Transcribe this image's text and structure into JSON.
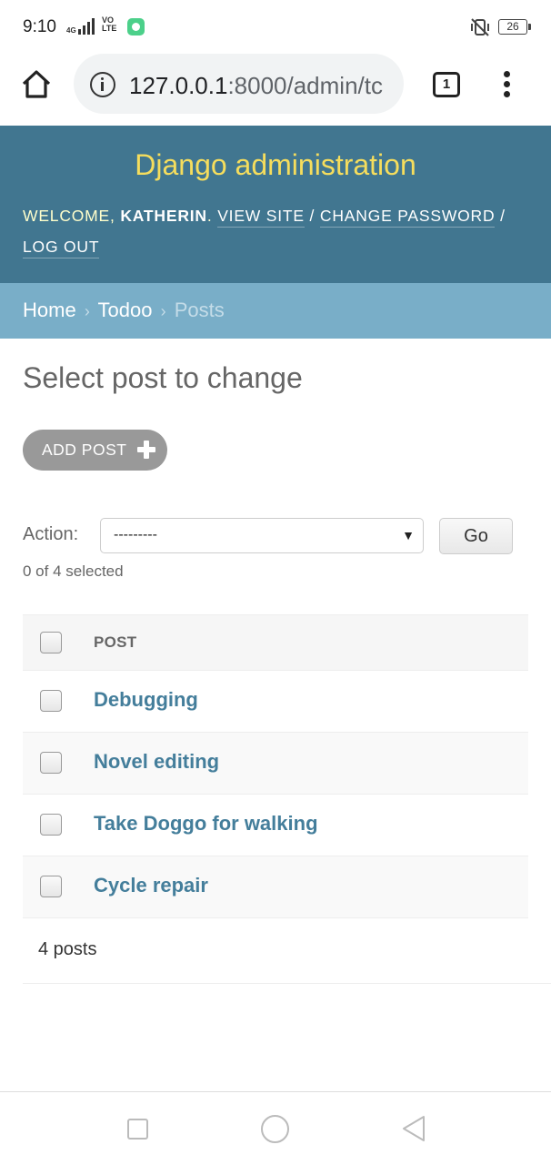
{
  "status_bar": {
    "time": "9:10",
    "network": "4G",
    "volte": "VO\nLTE",
    "battery": "26",
    "icons": [
      "signal-icon",
      "chat-app-icon",
      "mute-vibrate-icon",
      "battery-icon"
    ]
  },
  "browser": {
    "url_host": "127.0.0.1",
    "url_path": ":8000/admin/tc",
    "tab_count": "1",
    "icons": [
      "home-icon",
      "info-icon",
      "tabs-icon",
      "more-vert-icon"
    ]
  },
  "header": {
    "branding": "Django administration",
    "welcome_prefix": "WELCOME, ",
    "username": "KATHERIN",
    "period": ". ",
    "view_site": "VIEW SITE",
    "sep1": " / ",
    "change_password": "CHANGE PASSWORD",
    "sep2": " /",
    "log_out": "LOG OUT"
  },
  "breadcrumbs": {
    "home": "Home",
    "app": "Todoo",
    "current": "Posts",
    "separator": "›"
  },
  "content": {
    "title": "Select post to change",
    "add_button": "ADD POST",
    "action_label": "Action:",
    "action_value": "---------",
    "go_button": "Go",
    "selected_count": "0 of 4 selected",
    "column_header": "POST",
    "rows": [
      "Debugging",
      "Novel editing",
      "Take Doggo for walking",
      "Cycle repair"
    ],
    "paginator": "4 posts"
  },
  "colors": {
    "header_bg": "#417690",
    "branding": "#f5dd5d",
    "breadcrumbs_bg": "#79aec8",
    "link": "#447e9b"
  }
}
